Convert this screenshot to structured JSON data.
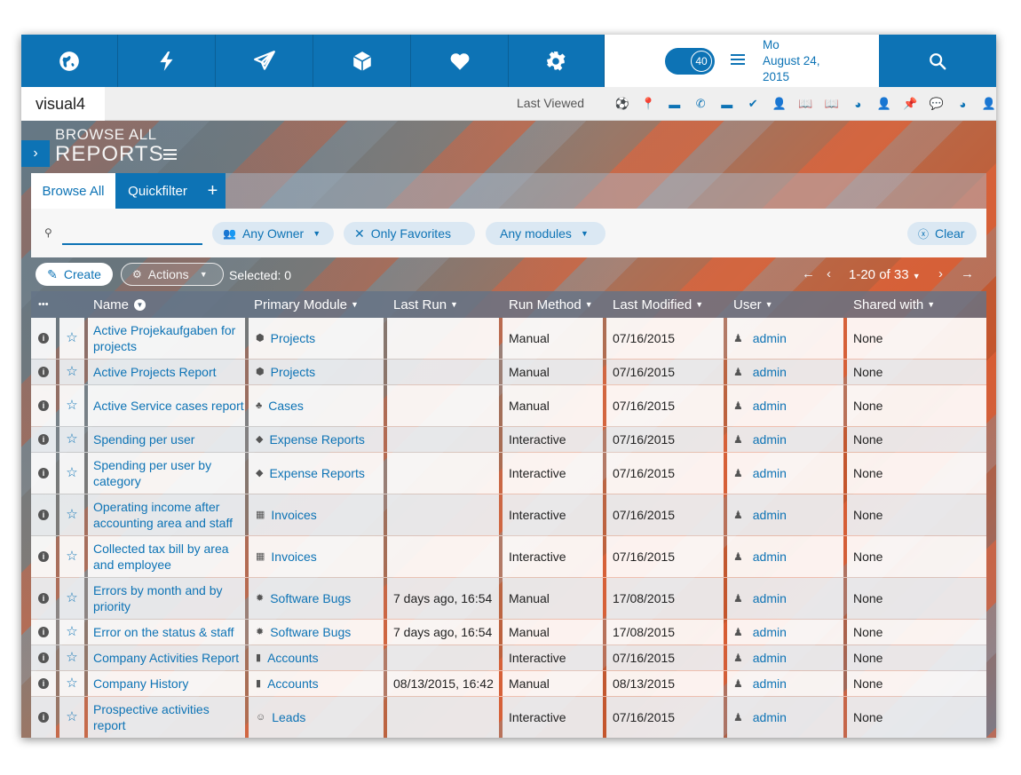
{
  "topbar": {
    "nav_icons": [
      "globe-icon",
      "lightning-icon",
      "paper-plane-icon",
      "cube-icon",
      "heart-icon",
      "gear-icon"
    ],
    "badge_count": "40",
    "date": {
      "line1": "Mo",
      "line2": "August 24,",
      "line3": "2015"
    },
    "search_icon": "search-icon"
  },
  "secbar": {
    "brand": "visual4",
    "last_viewed_label": "Last Viewed",
    "last_viewed_icons": [
      {
        "name": "soccer-ball-icon",
        "glyph": "⚽"
      },
      {
        "name": "pin-icon",
        "glyph": "📍"
      },
      {
        "name": "card-icon",
        "glyph": "▬"
      },
      {
        "name": "phone-icon",
        "glyph": "✆"
      },
      {
        "name": "card-icon",
        "glyph": "▬"
      },
      {
        "name": "check-circle-icon",
        "glyph": "✔"
      },
      {
        "name": "user-icon",
        "glyph": "👤"
      },
      {
        "name": "book-icon",
        "glyph": "📖"
      },
      {
        "name": "book-icon",
        "glyph": "📖"
      },
      {
        "name": "pie-chart-icon",
        "glyph": "◕"
      },
      {
        "name": "user-icon",
        "glyph": "👤"
      },
      {
        "name": "pushpin-icon",
        "glyph": "📌"
      },
      {
        "name": "chat-icon",
        "glyph": "💬"
      },
      {
        "name": "pie-chart-icon",
        "glyph": "◕"
      },
      {
        "name": "user-icon",
        "glyph": "👤"
      }
    ]
  },
  "page": {
    "title_sup": "BROWSE ALL",
    "title": "REPORTS"
  },
  "tabs": {
    "browse_all": "Browse All",
    "quickfilter": "Quickfilter",
    "add": "+"
  },
  "filters": {
    "search_value": "",
    "any_owner": "Any Owner",
    "only_favorites": "Only Favorites",
    "any_modules": "Any modules",
    "clear": "Clear"
  },
  "actions": {
    "create": "Create",
    "actions": "Actions",
    "selected": "Selected: 0",
    "pager": "1-20 of 33"
  },
  "table": {
    "headers": {
      "more": "•••",
      "name": "Name",
      "primary_module": "Primary Module",
      "last_run": "Last Run",
      "run_method": "Run Method",
      "last_modified": "Last Modified",
      "user": "User",
      "shared_with": "Shared with"
    },
    "rows": [
      {
        "name": "Active Projekaufgaben for projects",
        "module": "Projects",
        "module_icon": "cube-icon",
        "module_glyph": "⬢",
        "last_run": "",
        "method": "Manual",
        "modified": "07/16/2015",
        "user": "admin",
        "shared": "None",
        "lines": 2
      },
      {
        "name": "Active Projects Report",
        "module": "Projects",
        "module_icon": "cube-icon",
        "module_glyph": "⬢",
        "last_run": "",
        "method": "Manual",
        "modified": "07/16/2015",
        "user": "admin",
        "shared": "None",
        "lines": 1
      },
      {
        "name": "Active Service cases report",
        "module": "Cases",
        "module_icon": "cases-icon",
        "module_glyph": "♣",
        "last_run": "",
        "method": "Manual",
        "modified": "07/16/2015",
        "user": "admin",
        "shared": "None",
        "lines": 2
      },
      {
        "name": "Spending per user",
        "module": "Expense Reports",
        "module_icon": "expense-icon",
        "module_glyph": "◆",
        "last_run": "",
        "method": "Interactive",
        "modified": "07/16/2015",
        "user": "admin",
        "shared": "None",
        "lines": 1
      },
      {
        "name": "Spending per user by category",
        "module": "Expense Reports",
        "module_icon": "expense-icon",
        "module_glyph": "◆",
        "last_run": "",
        "method": "Interactive",
        "modified": "07/16/2015",
        "user": "admin",
        "shared": "None",
        "lines": 2
      },
      {
        "name": "Operating income after accounting area and staff",
        "module": "Invoices",
        "module_icon": "invoice-icon",
        "module_glyph": "▦",
        "last_run": "",
        "method": "Interactive",
        "modified": "07/16/2015",
        "user": "admin",
        "shared": "None",
        "lines": 2
      },
      {
        "name": "Collected tax bill by area and employee",
        "module": "Invoices",
        "module_icon": "invoice-icon",
        "module_glyph": "▦",
        "last_run": "",
        "method": "Interactive",
        "modified": "07/16/2015",
        "user": "admin",
        "shared": "None",
        "lines": 2
      },
      {
        "name": "Errors by month and by priority",
        "module": "Software Bugs",
        "module_icon": "bug-icon",
        "module_glyph": "✹",
        "last_run": "7 days ago, 16:54",
        "method": "Manual",
        "modified": "17/08/2015",
        "user": "admin",
        "shared": "None",
        "lines": 2
      },
      {
        "name": "Error on the status & staff",
        "module": "Software Bugs",
        "module_icon": "bug-icon",
        "module_glyph": "✹",
        "last_run": "7 days ago, 16:54",
        "method": "Manual",
        "modified": "17/08/2015",
        "user": "admin",
        "shared": "None",
        "lines": 1
      },
      {
        "name": "Company Activities Report",
        "module": "Accounts",
        "module_icon": "book-icon",
        "module_glyph": "▮",
        "last_run": "",
        "method": "Interactive",
        "modified": "07/16/2015",
        "user": "admin",
        "shared": "None",
        "lines": 1
      },
      {
        "name": "Company History",
        "module": "Accounts",
        "module_icon": "book-icon",
        "module_glyph": "▮",
        "last_run": "08/13/2015, 16:42",
        "method": "Manual",
        "modified": "08/13/2015",
        "user": "admin",
        "shared": "None",
        "lines": 1
      },
      {
        "name": "Prospective activities report",
        "module": "Leads",
        "module_icon": "smiley-icon",
        "module_glyph": "☺",
        "last_run": "",
        "method": "Interactive",
        "modified": "07/16/2015",
        "user": "admin",
        "shared": "None",
        "lines": 2
      }
    ]
  },
  "colors": {
    "brand_blue": "#0d73b5",
    "accent_orange": "#e96237"
  }
}
